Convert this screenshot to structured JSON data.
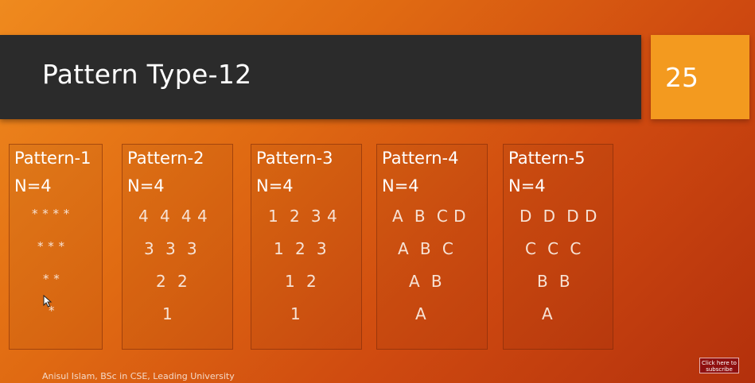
{
  "slide": {
    "title": "Pattern Type-12",
    "slide_number": "25",
    "footer": "Anisul Islam, BSc in CSE, Leading University",
    "subscribe_label": "Click here to subscribe"
  },
  "patterns": [
    {
      "heading": "Pattern-1",
      "n": "N=4",
      "rows": [
        "* * * *",
        "* * *",
        "* *",
        "*"
      ]
    },
    {
      "heading": "Pattern-2",
      "n": "N=4",
      "rows": [
        "4  4  4 4",
        "3  3  3",
        "2  2",
        "1"
      ]
    },
    {
      "heading": "Pattern-3",
      "n": "N=4",
      "rows": [
        "1  2  3 4",
        "1  2  3",
        "1  2",
        "1"
      ]
    },
    {
      "heading": "Pattern-4",
      "n": "N=4",
      "rows": [
        "A  B  C D",
        "A  B  C",
        "A  B",
        "A"
      ]
    },
    {
      "heading": "Pattern-5",
      "n": "N=4",
      "rows": [
        "D  D  D D",
        "C  C  C",
        "B  B",
        "A"
      ]
    }
  ]
}
